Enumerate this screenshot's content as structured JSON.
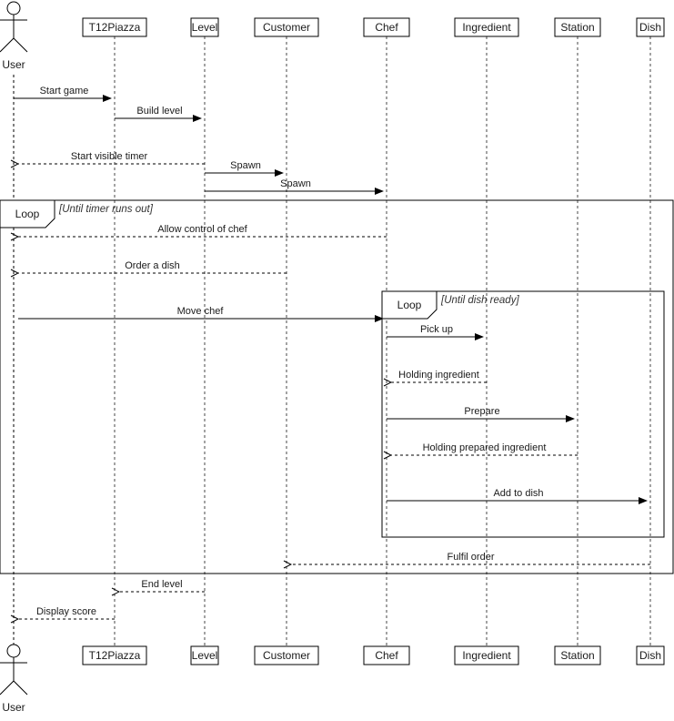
{
  "diagram": {
    "type": "sequence",
    "actor": {
      "id": "user",
      "label": "User"
    },
    "participants": [
      {
        "id": "user",
        "label": "User",
        "kind": "actor"
      },
      {
        "id": "t12piazza",
        "label": "T12Piazza",
        "kind": "object"
      },
      {
        "id": "level",
        "label": "Level",
        "kind": "object"
      },
      {
        "id": "customer",
        "label": "Customer",
        "kind": "object"
      },
      {
        "id": "chef",
        "label": "Chef",
        "kind": "object"
      },
      {
        "id": "ingredient",
        "label": "Ingredient",
        "kind": "object"
      },
      {
        "id": "station",
        "label": "Station",
        "kind": "object"
      },
      {
        "id": "dish",
        "label": "Dish",
        "kind": "object"
      }
    ],
    "messages": [
      {
        "label": "Start game",
        "from": "user",
        "to": "t12piazza",
        "style": "sync"
      },
      {
        "label": "Build level",
        "from": "t12piazza",
        "to": "level",
        "style": "sync"
      },
      {
        "label": "Start visible timer",
        "from": "level",
        "to": "user",
        "style": "return"
      },
      {
        "label": "Spawn",
        "from": "level",
        "to": "customer",
        "style": "sync"
      },
      {
        "label": "Spawn",
        "from": "level",
        "to": "chef",
        "style": "sync"
      },
      {
        "label": "Allow control of chef",
        "from": "chef",
        "to": "user",
        "style": "return"
      },
      {
        "label": "Order a dish",
        "from": "customer",
        "to": "user",
        "style": "return"
      },
      {
        "label": "Move chef",
        "from": "user",
        "to": "chef",
        "style": "sync"
      },
      {
        "label": "Pick up",
        "from": "chef",
        "to": "ingredient",
        "style": "sync"
      },
      {
        "label": "Holding ingredient",
        "from": "ingredient",
        "to": "chef",
        "style": "return"
      },
      {
        "label": "Prepare",
        "from": "chef",
        "to": "station",
        "style": "sync"
      },
      {
        "label": "Holding prepared ingredient",
        "from": "station",
        "to": "chef",
        "style": "return"
      },
      {
        "label": "Add to dish",
        "from": "chef",
        "to": "dish",
        "style": "sync"
      },
      {
        "label": "Fulfil order",
        "from": "dish",
        "to": "customer",
        "style": "return"
      },
      {
        "label": "End level",
        "from": "level",
        "to": "t12piazza",
        "style": "return"
      },
      {
        "label": "Display score",
        "from": "t12piazza",
        "to": "user",
        "style": "return"
      }
    ],
    "fragments": [
      {
        "operator": "Loop",
        "guard": "[Until timer runs out]",
        "first_message": 5,
        "last_message": 13
      },
      {
        "operator": "Loop",
        "guard": "[Until dish ready]",
        "first_message": 8,
        "last_message": 12
      }
    ]
  }
}
